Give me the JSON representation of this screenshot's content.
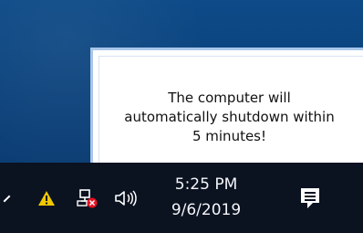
{
  "notification": {
    "message": "The computer will\nautomatically shutdown within\n5 minutes!"
  },
  "taskbar": {
    "icons": [
      "chevron-icon",
      "warning-icon",
      "network-error-icon",
      "volume-icon",
      "notification-icon"
    ],
    "clock": {
      "time": "5:25 PM",
      "date": "9/6/2019"
    }
  },
  "colors": {
    "desktop": "#0d4a87",
    "taskbar": "#0b1220",
    "warning": "#f0c800",
    "error": "#e81123"
  }
}
